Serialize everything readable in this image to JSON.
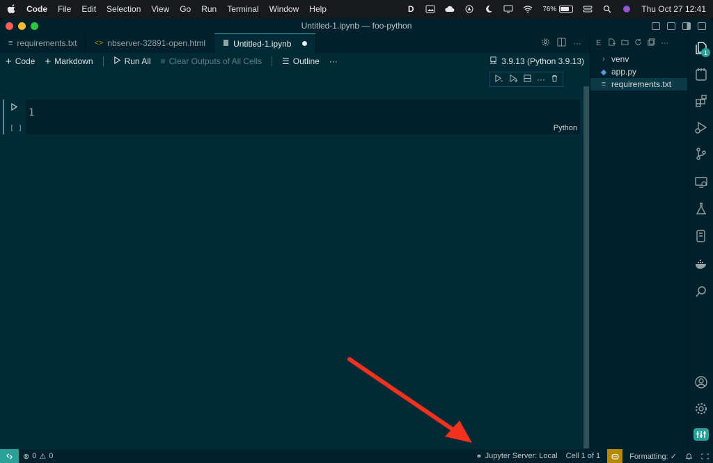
{
  "menubar": {
    "app": "Code",
    "items": [
      "File",
      "Edit",
      "Selection",
      "View",
      "Go",
      "Run",
      "Terminal",
      "Window",
      "Help"
    ],
    "battery": "76%",
    "datetime": "Thu Oct 27  12:41"
  },
  "window": {
    "title": "Untitled-1.ipynb — foo-python"
  },
  "tabs": [
    {
      "label": "requirements.txt",
      "icon": "lines-icon"
    },
    {
      "label": "nbserver-32891-open.html",
      "icon": "html-icon"
    },
    {
      "label": "Untitled-1.ipynb",
      "icon": "notebook-icon"
    }
  ],
  "toolbar": {
    "code": "Code",
    "markdown": "Markdown",
    "run_all": "Run All",
    "clear_outputs": "Clear Outputs of All Cells",
    "outline": "Outline",
    "more": "···",
    "kernel": "3.9.13 (Python 3.9.13)"
  },
  "cell": {
    "line_number": "1",
    "language": "Python",
    "exec_count": "[ ]"
  },
  "explorer": {
    "header": "E",
    "items": [
      {
        "label": "venv",
        "icon": "chevron-right-icon"
      },
      {
        "label": "app.py",
        "icon": "python-icon"
      },
      {
        "label": "requirements.txt",
        "icon": "lines-icon"
      }
    ]
  },
  "activity": {
    "explorer_badge": "1"
  },
  "statusbar": {
    "errors": "0",
    "warnings": "0",
    "jupyter": "Jupyter Server: Local",
    "cell_position": "Cell 1 of 1",
    "formatting": "Formatting: ✓"
  },
  "colors": {
    "editor_bg": "#002b36",
    "sidebar_bg": "#00212b",
    "accent": "#2aa198",
    "copilot": "#b58900",
    "arrow": "#f2311e"
  }
}
